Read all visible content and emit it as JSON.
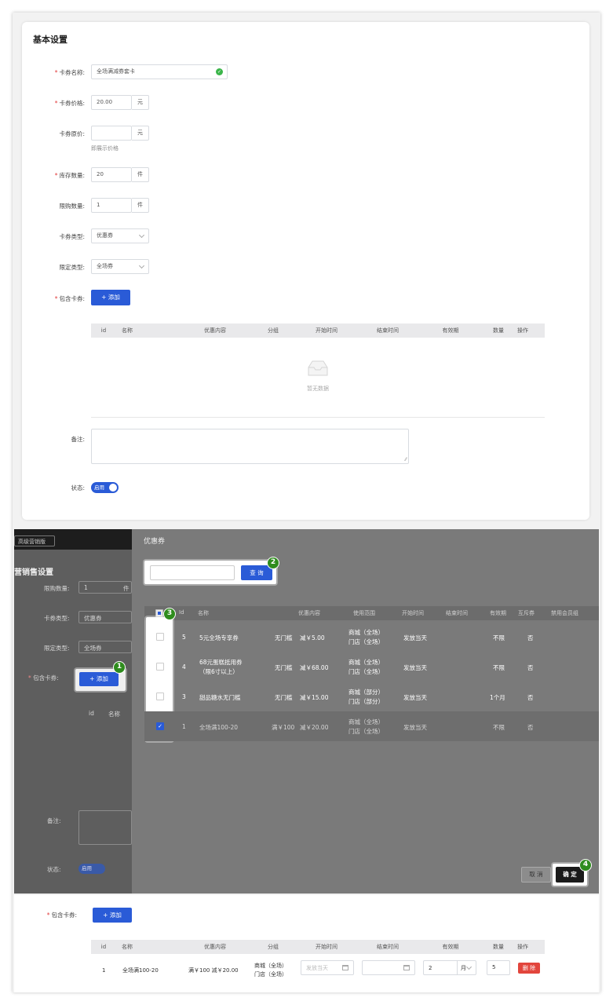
{
  "section_title": "基本设置",
  "form": {
    "name_label": "卡券名称:",
    "name_value": "全场满减券套卡",
    "price_label": "卡券价格:",
    "price_value": "20.00",
    "price_unit": "元",
    "orig_label": "卡券原价:",
    "orig_unit": "元",
    "orig_hint": "即展示价格",
    "stock_label": "库存数量:",
    "stock_value": "20",
    "stock_unit": "件",
    "limit_label": "限购数量:",
    "limit_value": "1",
    "limit_unit": "件",
    "type_label": "卡券类型:",
    "type_value": "优惠券",
    "scope_label": "限定类型:",
    "scope_value": "全场券",
    "include_label": "包含卡券:",
    "add_button": "+ 添加",
    "table_headers": [
      "id",
      "名称",
      "优惠内容",
      "分组",
      "开始时间",
      "结束时间",
      "有效期",
      "数量",
      "操作"
    ],
    "empty_text": "暂无数据",
    "remark_label": "备注:",
    "status_label": "状态:",
    "status_value": "启用"
  },
  "bg": {
    "top_button": "高级营销版",
    "title": "营销售设置",
    "limit_label": "限购数量:",
    "limit_value": "1",
    "limit_unit": "件",
    "type_label": "卡券类型:",
    "type_value": "优惠券",
    "scope_label": "限定类型:",
    "scope_value": "全场券",
    "include_label": "包含卡券:",
    "add_button": "+ 添加",
    "col_id": "id",
    "col_name": "名称",
    "remark_label": "备注:",
    "status_label": "状态:",
    "status_value": "启用"
  },
  "modal": {
    "title": "优惠券",
    "search_button": "查 询",
    "headers": [
      "Id",
      "名称",
      "优惠内容",
      "使用范围",
      "开始时间",
      "结束时间",
      "有效期",
      "互斥券",
      "禁用会员组"
    ],
    "rows": [
      {
        "id": "5",
        "name": "5元全场专享券",
        "threshold": "无门槛",
        "discount": "减￥5.00",
        "scope1": "商城（全场）",
        "scope2": "门店（全场）",
        "start": "发放当天",
        "validity": "不限",
        "exclusive": "否",
        "checked": false
      },
      {
        "id": "4",
        "name": "68元蛋糕抵用券",
        "name2": "（限6寸以上）",
        "threshold": "无门槛",
        "discount": "减￥68.00",
        "scope1": "商城（全场）",
        "scope2": "门店（全场）",
        "start": "发放当天",
        "validity": "不限",
        "exclusive": "否",
        "checked": false
      },
      {
        "id": "3",
        "name": "甜品糖水无门槛",
        "threshold": "无门槛",
        "discount": "减￥15.00",
        "scope1": "商城（部分）",
        "scope2": "门店（部分）",
        "start": "发放当天",
        "validity": "1个月",
        "exclusive": "否",
        "checked": false
      },
      {
        "id": "1",
        "name": "全场满100-20",
        "threshold": "满￥100",
        "discount": "减￥20.00",
        "scope1": "商城（全场）",
        "scope2": "门店（全场）",
        "start": "发放当天",
        "validity": "不限",
        "exclusive": "否",
        "checked": true
      }
    ],
    "cancel_button": "取 消",
    "confirm_button": "确 定"
  },
  "badges": [
    "1",
    "2",
    "3",
    "4"
  ],
  "result": {
    "include_label": "包含卡券:",
    "add_button": "+ 添加",
    "headers": [
      "id",
      "名称",
      "优惠内容",
      "分组",
      "开始时间",
      "结束时间",
      "有效期",
      "数量",
      "操作"
    ],
    "row": {
      "id": "1",
      "name": "全场满100-20",
      "content": "满￥100  减￥20.00",
      "group1": "商城（全场）",
      "group2": "门店（全场）",
      "start_placeholder": "发放当天",
      "validity_value": "2",
      "validity_unit": "月",
      "quantity": "5",
      "delete_button": "删 除"
    }
  },
  "colors": {
    "primary": "#2a5bd7",
    "required": "#e23b3b",
    "success": "#3bb54a",
    "danger": "#e2453c",
    "badge": "#2f8c1e"
  }
}
